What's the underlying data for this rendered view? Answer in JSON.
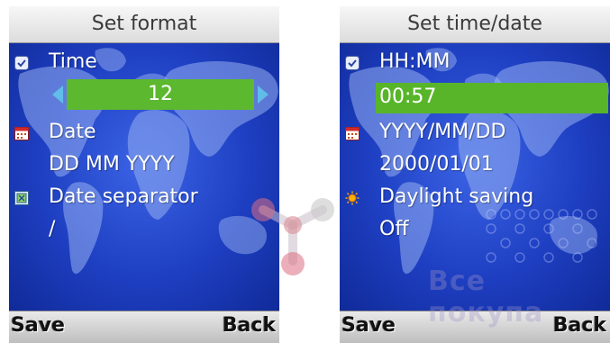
{
  "left_screen": {
    "title": "Set format",
    "time_label": "Time",
    "time_value": "12",
    "date_label": "Date",
    "date_value": "DD MM YYYY",
    "separator_label": "Date separator",
    "separator_value": "/",
    "softkey_left": "Save",
    "softkey_right": "Back"
  },
  "right_screen": {
    "title": "Set time/date",
    "time_format_label": "HH:MM",
    "time_value": "00:57",
    "date_format_label": "YYYY/MM/DD",
    "date_value": "2000/01/01",
    "daylight_label": "Daylight saving",
    "daylight_value": "Off",
    "softkey_left": "Save",
    "softkey_right": "Back"
  },
  "watermark": "Все покупа",
  "colors": {
    "highlight": "#5cb82f",
    "background": "#1e3fc2",
    "arrow": "#60bde9"
  },
  "icons": [
    "clock-icon",
    "calendar-icon",
    "separator-icon",
    "sun-icon"
  ]
}
